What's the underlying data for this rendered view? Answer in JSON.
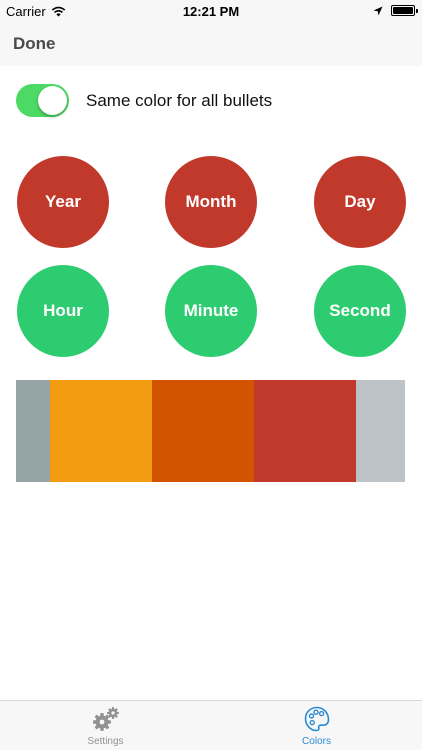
{
  "status_bar": {
    "carrier": "Carrier",
    "time": "12:21 PM"
  },
  "nav": {
    "done_label": "Done"
  },
  "settings": {
    "same_color_label": "Same color for all bullets",
    "same_color_on": true
  },
  "bullets": {
    "year": "Year",
    "month": "Month",
    "day": "Day",
    "hour": "Hour",
    "minute": "Minute",
    "second": "Second"
  },
  "colors": {
    "date_bullets": "#c0392b",
    "time_bullets": "#2ecc71",
    "toggle_on": "#4cd964",
    "tab_active": "#2a8ad4",
    "tab_inactive": "#929292"
  },
  "palette": [
    {
      "color": "#95a5a6",
      "share": 34
    },
    {
      "color": "#f39c12",
      "share": 102
    },
    {
      "color": "#d35400",
      "share": 102
    },
    {
      "color": "#c0392b",
      "share": 102
    },
    {
      "color": "#bdc3c7",
      "share": 49
    }
  ],
  "tabs": {
    "settings_label": "Settings",
    "settings_icon": "gears-icon",
    "colors_label": "Colors",
    "colors_icon": "palette-icon",
    "active": "colors"
  }
}
